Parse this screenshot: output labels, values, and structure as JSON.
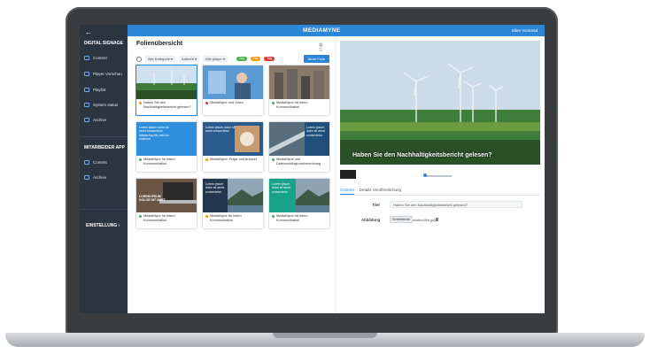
{
  "app": {
    "brand": "MEDIAMYNE",
    "user": "Ellen Vorstand"
  },
  "sidebar": {
    "sections": [
      {
        "title": "DIGITAL SIGNAGE",
        "items": [
          {
            "label": "Content",
            "icon": "content-icon"
          },
          {
            "label": "Player Vorschau",
            "icon": "monitor-icon"
          },
          {
            "label": "Playlist",
            "icon": "playlist-icon"
          },
          {
            "label": "System status",
            "icon": "status-icon"
          },
          {
            "label": "Archive",
            "icon": "archive-icon"
          }
        ]
      },
      {
        "title": "MITARBEIDER APP",
        "items": [
          {
            "label": "Content",
            "icon": "content-icon"
          },
          {
            "label": "Archive",
            "icon": "archive-icon"
          }
        ]
      }
    ],
    "settings": "EINSTELLUNG  ›"
  },
  "left_panel": {
    "title": "Folienübersicht",
    "filters": {
      "category": "Alle Kategorie ▾",
      "author": "Autoren ▾",
      "player": "Alle player ▾"
    },
    "tags": [
      {
        "label": "Tag",
        "color": "#4caf50"
      },
      {
        "label": "Tag",
        "color": "#ff9800"
      },
      {
        "label": "Tag",
        "color": "#e53935"
      }
    ],
    "new_button": "Neue Folie",
    "cards": [
      {
        "caption": "Haben Sie den Nachhaltigkeitsbericht gelesen?",
        "dot": "#ff9800",
        "thumb": "wind",
        "selected": true
      },
      {
        "caption": "MediaMyne und Video",
        "dot": "#e53935",
        "thumb": "phone"
      },
      {
        "caption": "MediaMyne für intern Kommunikation",
        "dot": "#4caf50",
        "thumb": "city"
      },
      {
        "caption": "MediaMyne für intern Kommunikation",
        "dot": "#4caf50",
        "thumb": "blue-text",
        "text": "Lorem ipsum dolor sit amet consectetur adipiscing elit, sed do eiusmod"
      },
      {
        "caption": "MediaMyne: Frage und Antwort",
        "dot": "#ff9800",
        "thumb": "coffee",
        "text": "Lorem ipsum dolor sit amet consectetur"
      },
      {
        "caption": "MediaMyne und Datenschutzgrundverordnung",
        "dot": "#4caf50",
        "thumb": "road",
        "text": "Lorem ipsum dolor sit amet consectetur"
      },
      {
        "caption": "MediaMyne für intern Kommunikation",
        "dot": "#4caf50",
        "thumb": "laptop",
        "text": "LOREM IPSUM DOLOR SIT AMET"
      },
      {
        "caption": "MediaMyne für intern Kommunikation",
        "dot": "#ff9800",
        "thumb": "lake-navy",
        "text": "Lorem ipsum dolor sit amet, consectetur"
      },
      {
        "caption": "MediaMyne für intern Kommunikation",
        "dot": "#4caf50",
        "thumb": "lake-teal",
        "text": "Lorem ipsum dolor sit amet, consectetur"
      }
    ]
  },
  "right_panel": {
    "preview_title": "Haben Sie den Nachhaltigkeitsbericht gelesen?",
    "tabs": [
      "Content",
      "Details Veröffentlichung"
    ],
    "fields": {
      "title_label": "Titel",
      "title_value": "Haben Sie den Nachhaltigkeitsbericht gelesen?",
      "image_label": "Abbildung",
      "select_button": "Selektieren",
      "file_name": "windmühle.jpg"
    }
  }
}
